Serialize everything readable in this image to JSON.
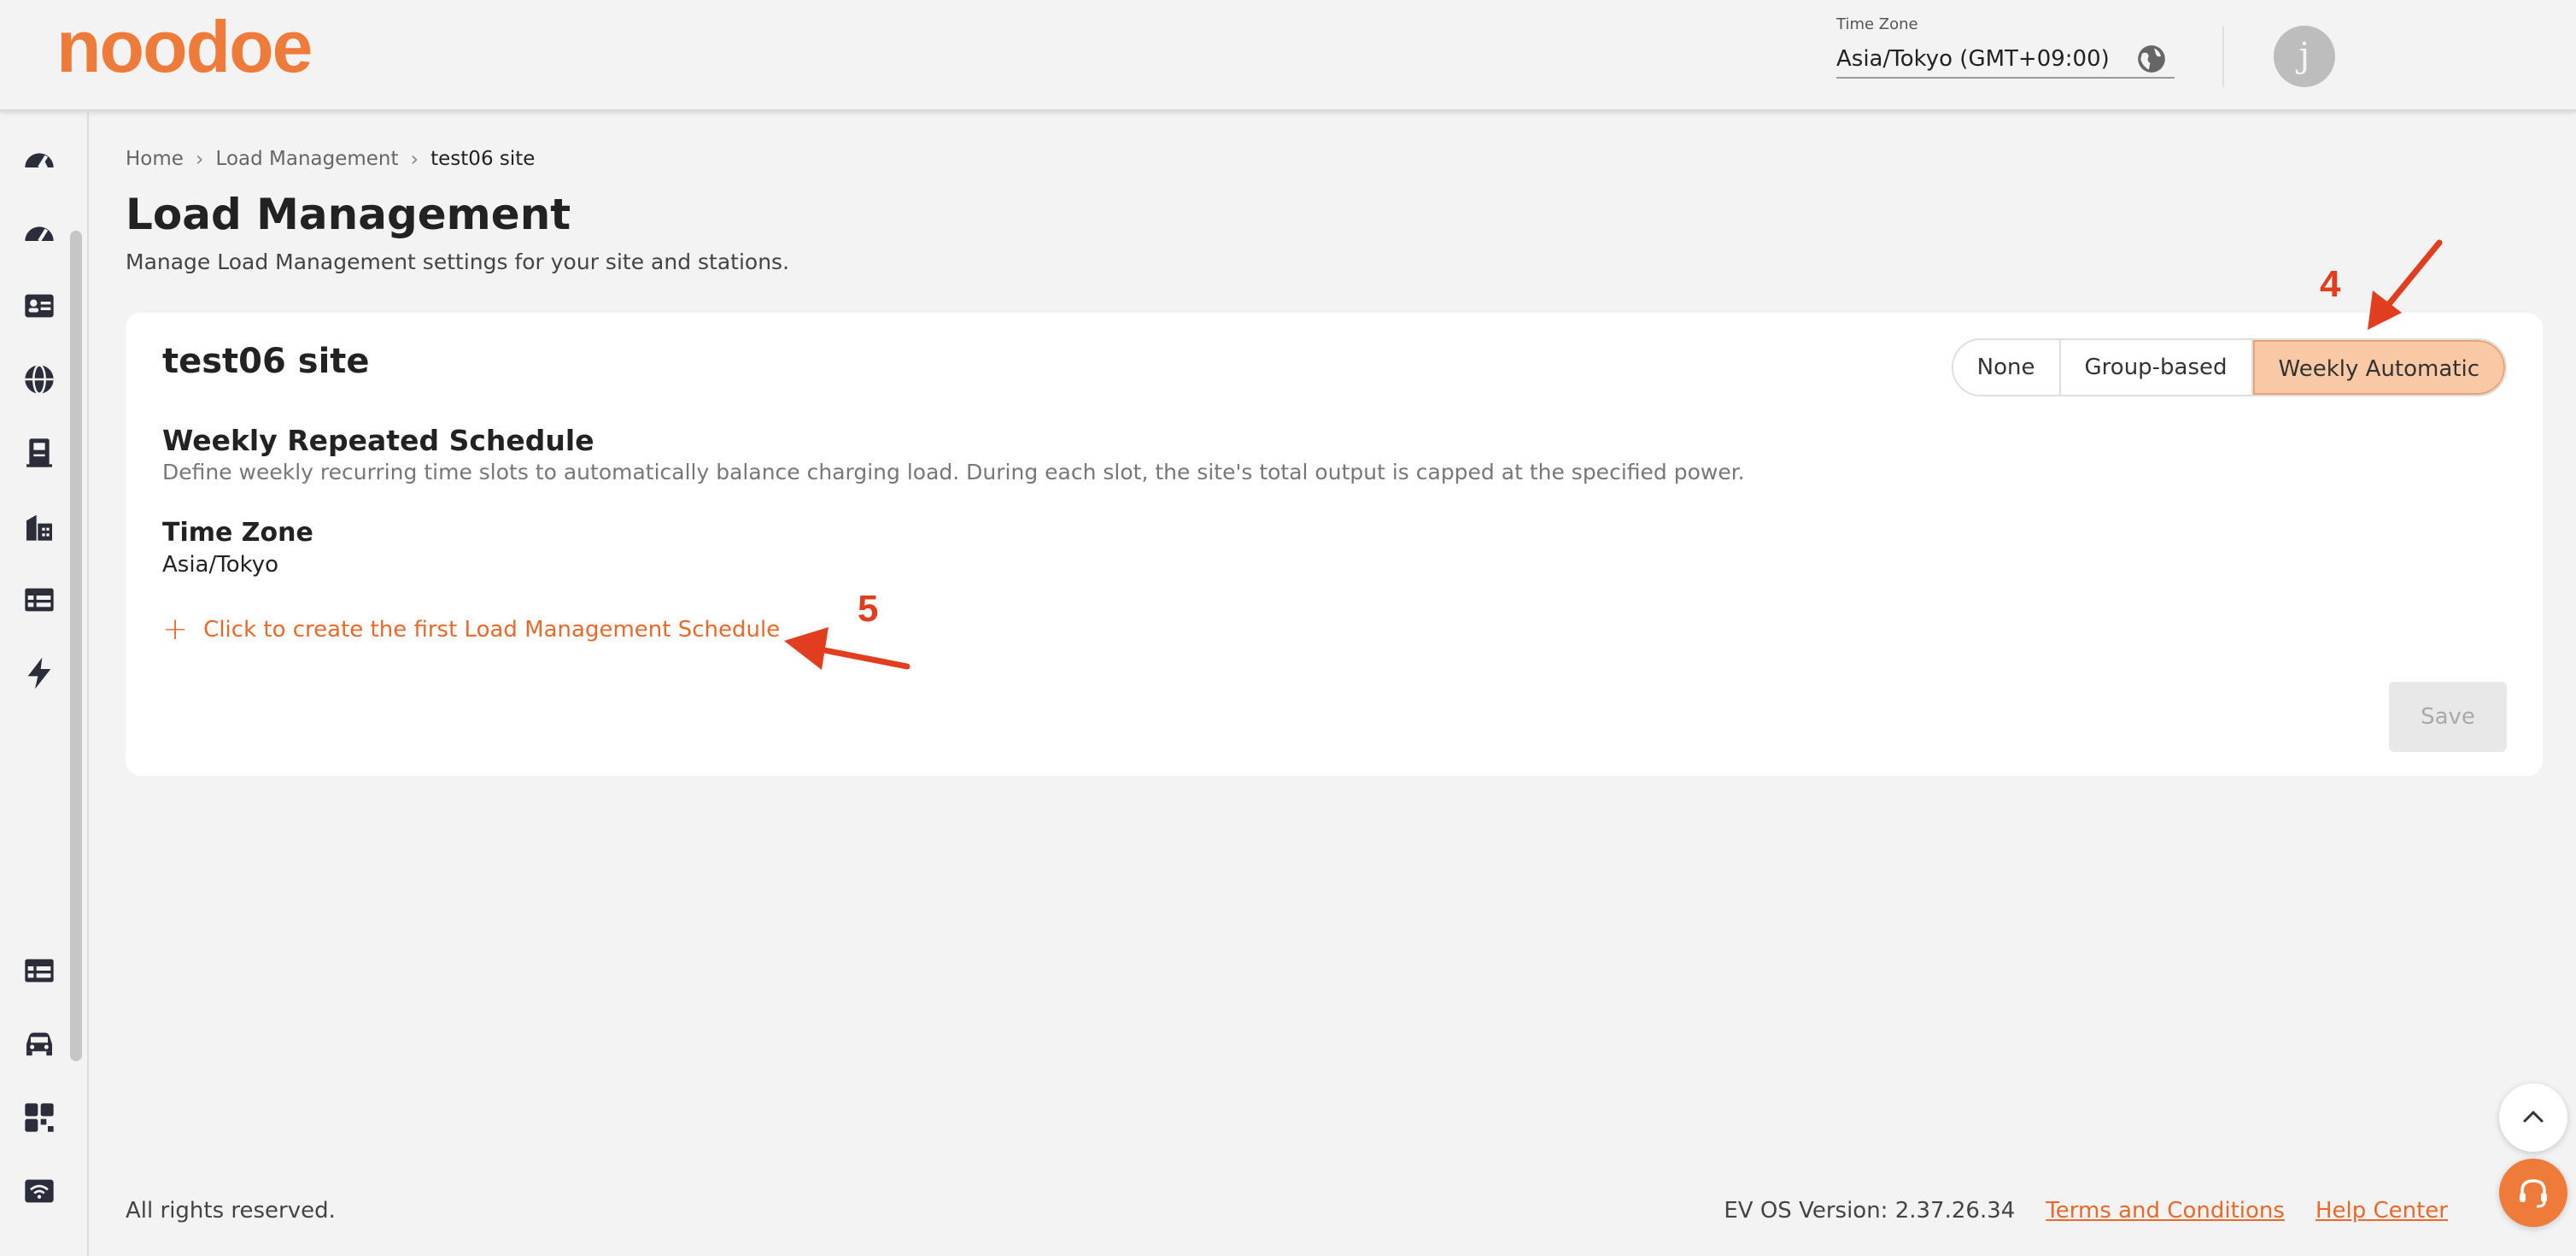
{
  "brand": {
    "logo_text": "noodoe",
    "accent": "#ef7b3b"
  },
  "header": {
    "timezone_label": "Time Zone",
    "timezone_value": "Asia/Tokyo (GMT+09:00)",
    "avatar_initial": "j"
  },
  "sidebar": {
    "items": [
      {
        "icon": "dashboard-icon"
      },
      {
        "icon": "dashboard-alt-icon"
      },
      {
        "icon": "id-card-icon"
      },
      {
        "icon": "globe-icon"
      },
      {
        "icon": "charger-icon"
      },
      {
        "icon": "buildings-icon"
      },
      {
        "icon": "table-icon"
      },
      {
        "icon": "lightning-icon"
      }
    ],
    "bottom_items": [
      {
        "icon": "table-icon"
      },
      {
        "icon": "car-icon"
      },
      {
        "icon": "qr-code-icon"
      },
      {
        "icon": "wifi-icon"
      }
    ]
  },
  "breadcrumb": {
    "items": [
      "Home",
      "Load Management",
      "test06 site"
    ]
  },
  "page": {
    "title": "Load Management",
    "subtitle": "Manage Load Management settings for your site and stations."
  },
  "card": {
    "site_name": "test06 site",
    "mode_options": [
      "None",
      "Group-based",
      "Weekly Automatic"
    ],
    "selected_mode": "Weekly Automatic",
    "section_title": "Weekly Repeated Schedule",
    "section_desc": "Define weekly recurring time slots to automatically balance charging load. During each slot, the site's total output is capped at the specified power.",
    "timezone_title": "Time Zone",
    "timezone_value": "Asia/Tokyo",
    "create_link": "Click to create the first Load Management Schedule",
    "save_label": "Save"
  },
  "annotations": {
    "step4": "4",
    "step5": "5",
    "color": "#e03e1e"
  },
  "footer": {
    "copyright": "All rights reserved.",
    "version": "EV OS Version: 2.37.26.34",
    "terms": "Terms and Conditions",
    "help": "Help Center"
  }
}
